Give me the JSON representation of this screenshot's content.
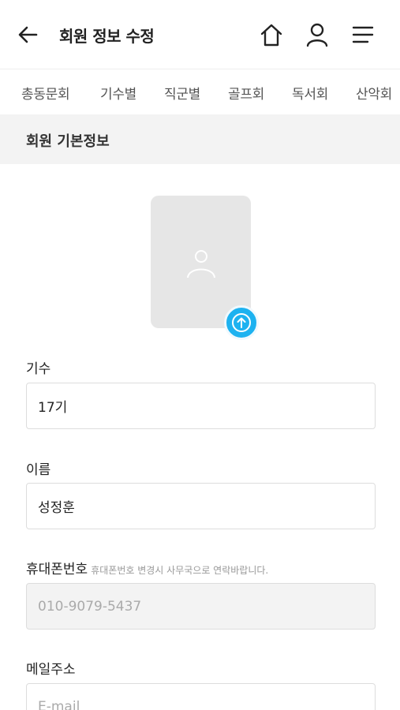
{
  "header": {
    "title": "회원 정보 수정",
    "back_icon": "back-arrow-icon",
    "home_icon": "home-icon",
    "user_icon": "user-icon",
    "menu_icon": "hamburger-menu-icon"
  },
  "tabs": [
    {
      "label": "총동문회"
    },
    {
      "label": "기수별"
    },
    {
      "label": "직군별"
    },
    {
      "label": "골프회"
    },
    {
      "label": "독서회"
    },
    {
      "label": "산악회"
    }
  ],
  "section": {
    "title": "회원 기본정보"
  },
  "photo": {
    "placeholder_icon": "person-icon",
    "upload_icon": "upload-icon",
    "upload_color": "#1db2f0"
  },
  "form": {
    "generation": {
      "label": "기수",
      "value": "17기"
    },
    "name": {
      "label": "이름",
      "value": "성정훈"
    },
    "phone": {
      "label": "휴대폰번호",
      "note": "휴대폰번호 변경시 사무국으로 연락바랍니다.",
      "value": "010-9079-5437"
    },
    "email": {
      "label": "메일주소",
      "placeholder": "E-mail",
      "value": ""
    }
  }
}
